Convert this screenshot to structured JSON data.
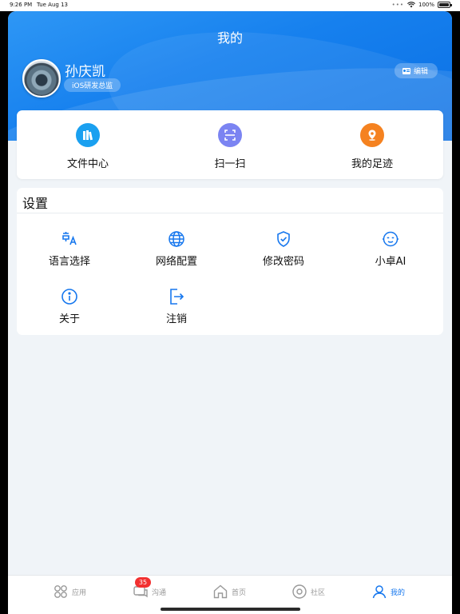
{
  "status_bar": {
    "time": "9:26 PM",
    "date": "Tue Aug 13",
    "dots": "•••",
    "battery": "100%"
  },
  "header": {
    "title": "我的"
  },
  "user": {
    "name": "孙庆凯",
    "role": "iOS研发总监",
    "edit_label": "编辑"
  },
  "quick_actions": [
    {
      "label": "文件中心",
      "icon": "folder-stack-icon",
      "color": "#1aa0f0"
    },
    {
      "label": "扫一扫",
      "icon": "scan-icon",
      "color": "#7b84f2"
    },
    {
      "label": "我的足迹",
      "icon": "location-pin-icon",
      "color": "#f58220"
    }
  ],
  "settings": {
    "title": "设置",
    "items": [
      {
        "label": "语言选择",
        "icon": "language-icon"
      },
      {
        "label": "网络配置",
        "icon": "globe-icon"
      },
      {
        "label": "修改密码",
        "icon": "shield-check-icon"
      },
      {
        "label": "小卓AI",
        "icon": "robot-face-icon"
      },
      {
        "label": "关于",
        "icon": "info-icon"
      },
      {
        "label": "注销",
        "icon": "logout-icon"
      }
    ]
  },
  "tabbar": {
    "items": [
      {
        "label": "应用",
        "icon": "apps-grid-icon"
      },
      {
        "label": "沟通",
        "icon": "chat-icon",
        "badge": "35"
      },
      {
        "label": "首页",
        "icon": "home-icon"
      },
      {
        "label": "社区",
        "icon": "community-icon"
      },
      {
        "label": "我的",
        "icon": "profile-icon",
        "active": true
      }
    ]
  },
  "colors": {
    "accent": "#1677ee",
    "header_blue": "#1680ee",
    "badge_red": "#f23030"
  }
}
